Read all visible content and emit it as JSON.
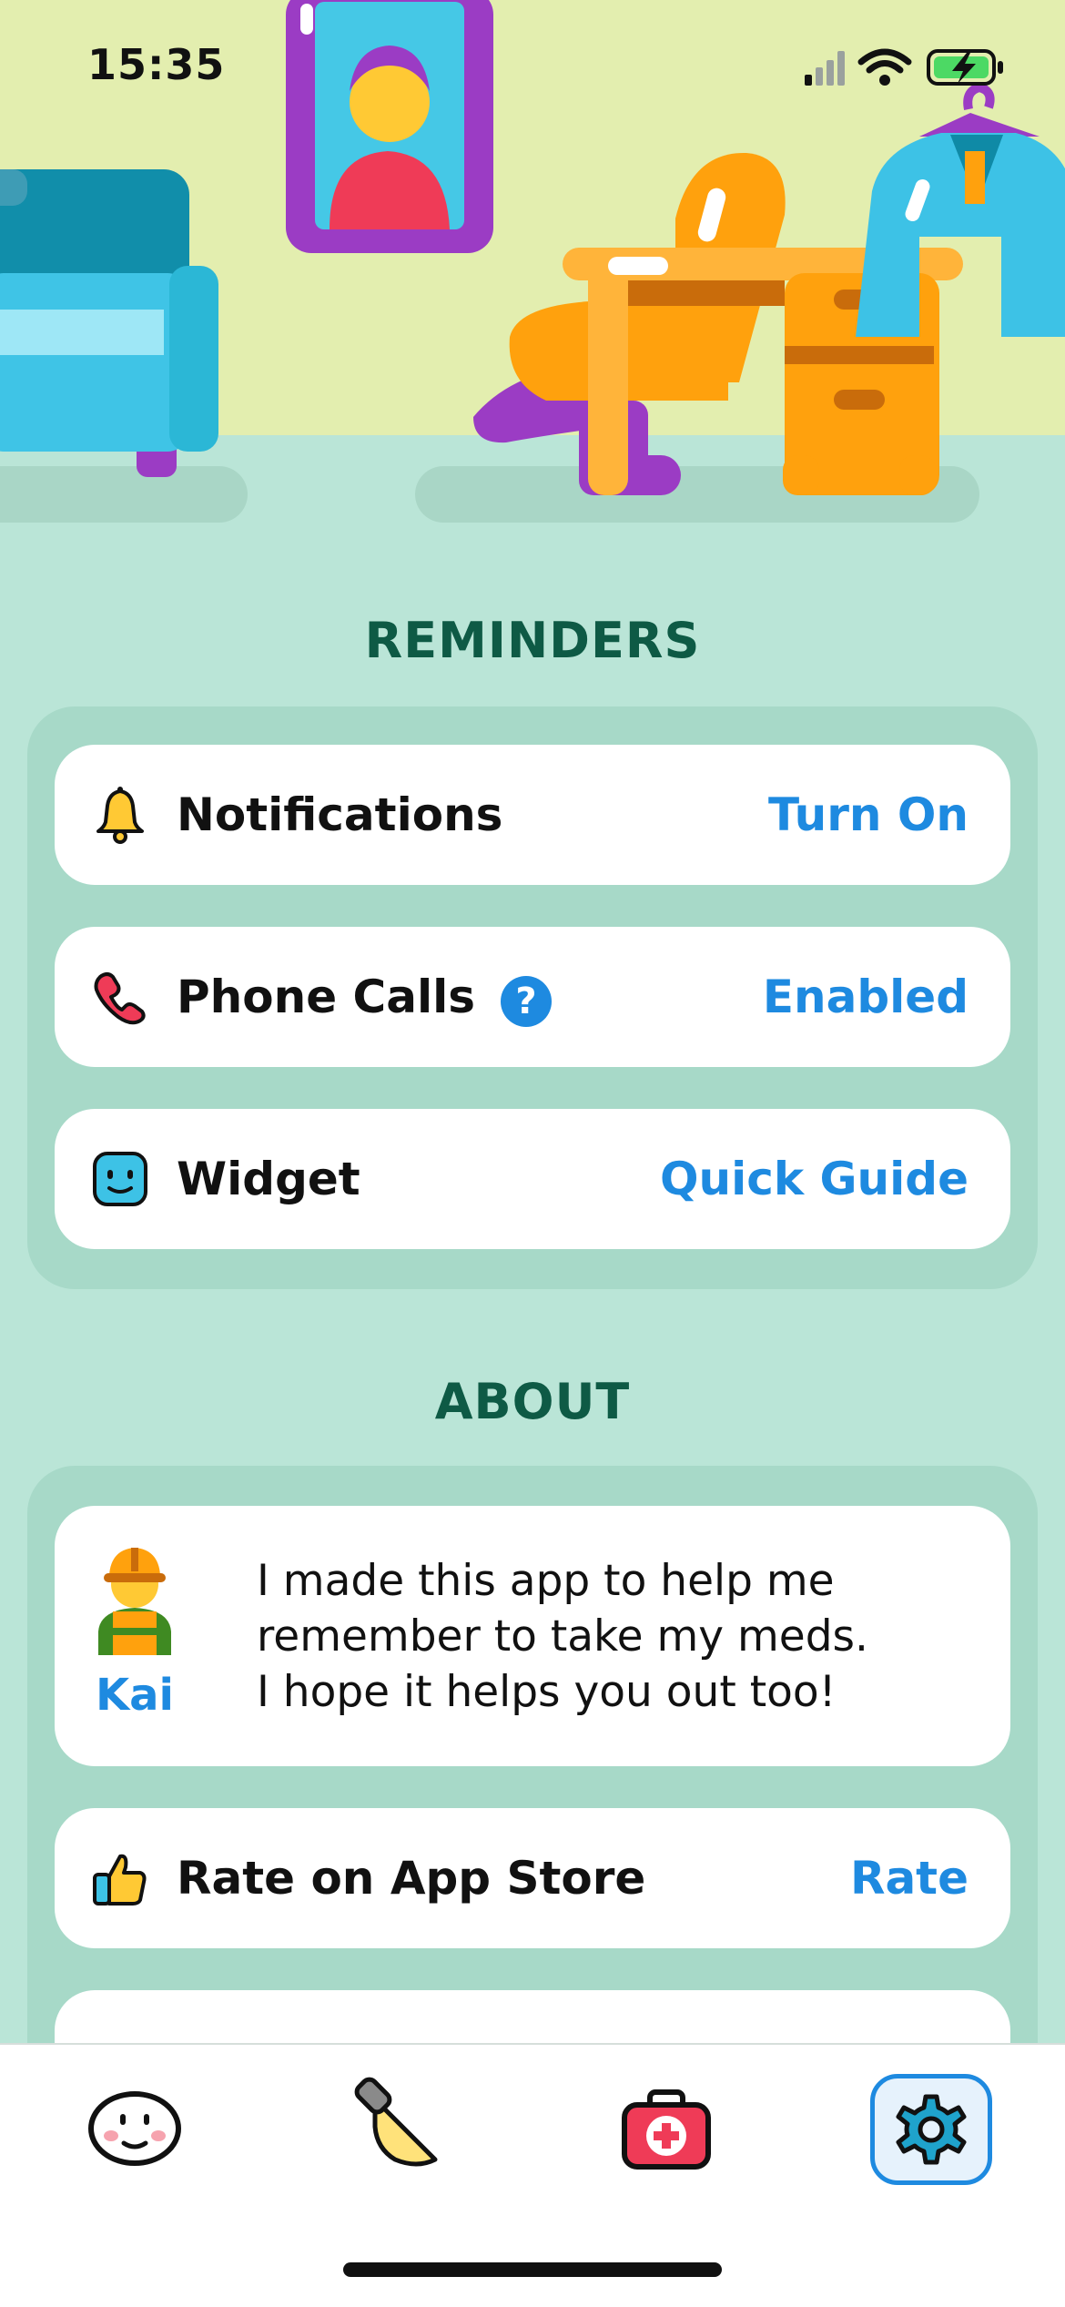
{
  "status_bar": {
    "time": "15:35"
  },
  "reminders": {
    "title": "REMINDERS",
    "items": [
      {
        "label": "Notifications",
        "action": "Turn On",
        "icon": "bell-icon"
      },
      {
        "label": "Phone Calls",
        "action": "Enabled",
        "icon": "phone-icon",
        "help": "?"
      },
      {
        "label": "Widget",
        "action": "Quick Guide",
        "icon": "widget-face-icon"
      }
    ]
  },
  "about": {
    "title": "ABOUT",
    "author": {
      "name": "Kai",
      "message_lines": [
        "I made this app to help me",
        "remember to take my meds.",
        "I hope it helps you out too!"
      ]
    },
    "rate": {
      "label": "Rate on App Store",
      "action": "Rate",
      "icon": "thumbs-up-icon"
    }
  },
  "tab_bar": {
    "tabs": [
      {
        "name": "mood-face-icon",
        "active": false
      },
      {
        "name": "spotlight-icon",
        "active": false
      },
      {
        "name": "medical-kit-icon",
        "active": false
      },
      {
        "name": "settings-gear-icon",
        "active": true
      }
    ]
  },
  "colors": {
    "background": "#BAE5D7",
    "wall": "#E3EEAF",
    "section_title": "#0E5A45",
    "accent": "#1E8AE0",
    "group_bg": "#A7D9C8"
  }
}
